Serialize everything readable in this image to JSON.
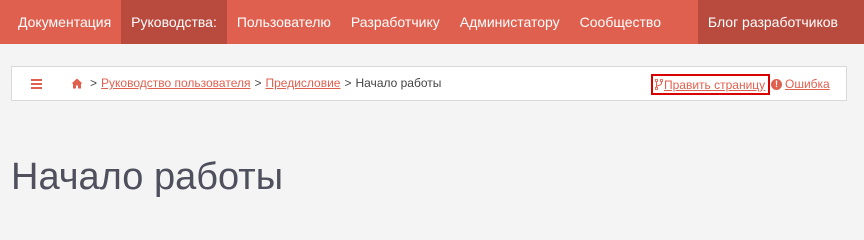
{
  "nav": {
    "items": [
      {
        "label": "Документация"
      },
      {
        "label": "Руководства:"
      },
      {
        "label": "Пользователю"
      },
      {
        "label": "Разработчику"
      },
      {
        "label": "Администатору"
      },
      {
        "label": "Сообщество"
      },
      {
        "label": "Блог разработчиков"
      }
    ],
    "active_index": 1
  },
  "breadcrumb": {
    "items": [
      {
        "label": "Руководство пользователя"
      },
      {
        "label": "Предисловие"
      }
    ],
    "separator": ">",
    "current": "Начало работы"
  },
  "actions": {
    "edit_label": "Править страницу",
    "issue_label": "Ошибка"
  },
  "page": {
    "title": "Начало работы"
  },
  "colors": {
    "accent": "#e0604f",
    "nav_active": "#b94a3e",
    "highlight_border": "#d90000",
    "title": "#4f4f5d",
    "background": "#f4f4f4"
  },
  "icons": {
    "menu": "bars-icon",
    "home": "home-icon",
    "edit": "code-fork-icon",
    "issue": "exclamation-circle-icon"
  }
}
